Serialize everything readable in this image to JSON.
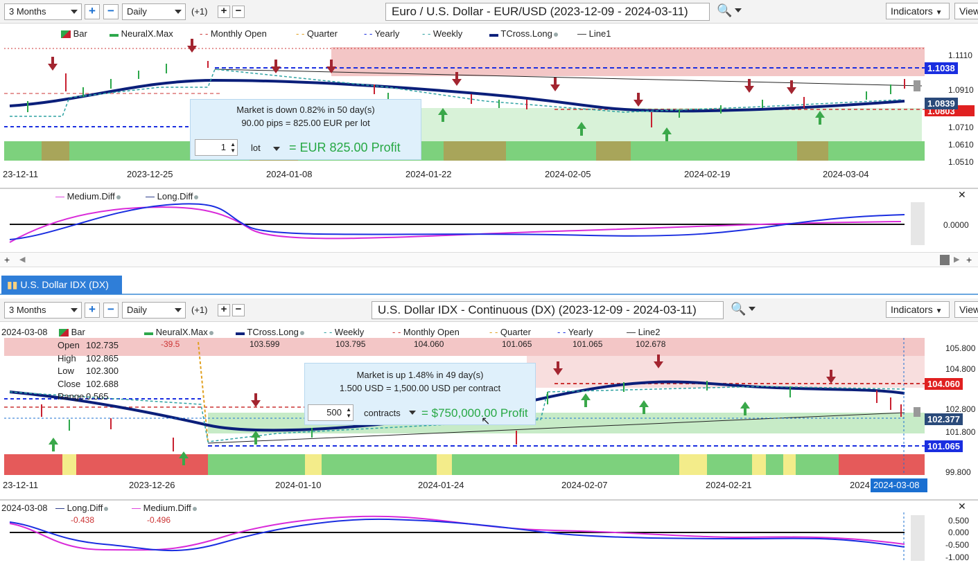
{
  "top_toolbar": {
    "period": "3 Months",
    "interval": "Daily",
    "offset": "(+1)",
    "title": "Euro / U.S. Dollar - EUR/USD (2023-12-09 - 2024-03-11)",
    "indicators_label": "Indicators",
    "view_label": "View"
  },
  "top_legend": [
    "Bar",
    "NeuralX.Max",
    "Monthly Open",
    "Quarter",
    "Yearly",
    "Weekly",
    "TCross.Long",
    "Line1"
  ],
  "top_prices": {
    "tick_1": "1.1110",
    "tick_2": "1.0910",
    "tick_3": "1.0710",
    "tick_4": "1.0610",
    "tick_5": "1.0510",
    "yearly_box": "1.1038",
    "tcross_box": "1.0839",
    "hidden_box": "1.0803"
  },
  "top_dates": [
    "23-12-11",
    "2023-12-25",
    "2024-01-08",
    "2024-01-22",
    "2024-02-05",
    "2024-02-19",
    "2024-03-04"
  ],
  "top_tooltip": {
    "line1": "Market is down 0.82% in 50 day(s)",
    "line2": "90.00 pips = 825.00 EUR per lot",
    "qty": "1",
    "unit": "lot",
    "profit": "= EUR 825.00 Profit"
  },
  "top_sub": {
    "legend": [
      "Medium.Diff",
      "Long.Diff"
    ],
    "zero_label": "0.0000"
  },
  "dx_tab": {
    "label": "U.S. Dollar IDX (DX)"
  },
  "bottom_toolbar": {
    "period": "3 Months",
    "interval": "Daily",
    "offset": "(+1)",
    "title": "U.S. Dollar IDX - Continuous (DX) (2023-12-09 - 2024-03-11)",
    "indicators_label": "Indicators",
    "view_label": "View"
  },
  "bottom_legend": {
    "date": "2024-03-08",
    "items": [
      "Bar",
      "NeuralX.Max",
      "TCross.Long",
      "Weekly",
      "Monthly Open",
      "Quarter",
      "Yearly",
      "Line2"
    ],
    "values": [
      "-39.5",
      "103.599",
      "103.795",
      "104.060",
      "101.065",
      "101.065",
      "102.678"
    ]
  },
  "ohlc": {
    "open_label": "Open",
    "open": "102.735",
    "high_label": "High",
    "high": "102.865",
    "low_label": "Low",
    "low": "102.300",
    "close_label": "Close",
    "close": "102.688",
    "range_label": "Range",
    "range": "0.565"
  },
  "bottom_prices": {
    "tick_1": "105.800",
    "tick_2": "104.800",
    "tick_3": "102.800",
    "tick_4": "101.800",
    "tick_5": "99.800",
    "monthly_box": "104.060",
    "price_box": "102.377",
    "yearly_box": "101.065"
  },
  "bottom_dates": [
    "23-12-11",
    "2023-12-26",
    "2024-01-10",
    "2024-01-24",
    "2024-02-07",
    "2024-02-21",
    "2024"
  ],
  "bottom_date_highlight": "2024-03-08",
  "bottom_tooltip": {
    "line1": "Market is up 1.48% in 49 day(s)",
    "line2": "1.500 USD = 1,500.00 USD per contract",
    "qty": "500",
    "unit": "contracts",
    "profit": "= $750,000.00 Profit"
  },
  "bottom_sub": {
    "date": "2024-03-08",
    "legend": [
      "Long.Diff",
      "Medium.Diff"
    ],
    "values": [
      "-0.438",
      "-0.496"
    ],
    "ticks": [
      "0.500",
      "0.000",
      "-0.500",
      "-1.000"
    ]
  },
  "colors": {
    "red": "#b0202a",
    "green": "#2ca74a",
    "navy": "#0b1f7a",
    "blue_dash": "#1a2ee0",
    "magenta": "#d92ad9",
    "accent": "#1a6fd1"
  }
}
